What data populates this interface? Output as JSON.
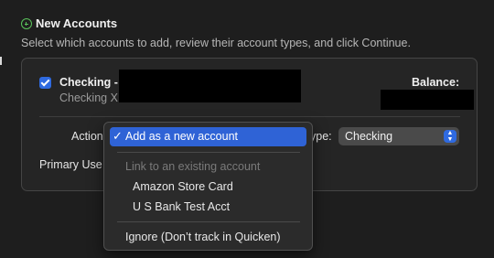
{
  "header": {
    "title": "New Accounts",
    "subtitle": "Select which accounts to add, review their account types, and click Continue."
  },
  "account": {
    "checked": true,
    "name": "Checking -",
    "subname": "Checking X",
    "balance_label": "Balance:"
  },
  "fields": {
    "action_label": "Action",
    "type_label": "ype:",
    "type_value": "Checking",
    "primary_label": "Primary Use"
  },
  "menu": {
    "check_glyph": "✓",
    "items": [
      {
        "label": "Add as a new account",
        "state": "selected"
      },
      {
        "label": "Link to an existing account",
        "state": "disabled"
      },
      {
        "label": "Amazon Store Card",
        "state": "normal"
      },
      {
        "label": "U S Bank Test Acct",
        "state": "normal"
      },
      {
        "label": "Ignore (Don’t track in Quicken)",
        "state": "normal"
      }
    ]
  },
  "colors": {
    "accent": "#2f6ae0",
    "add_icon": "#59c35a",
    "background": "#1e1e1e"
  }
}
